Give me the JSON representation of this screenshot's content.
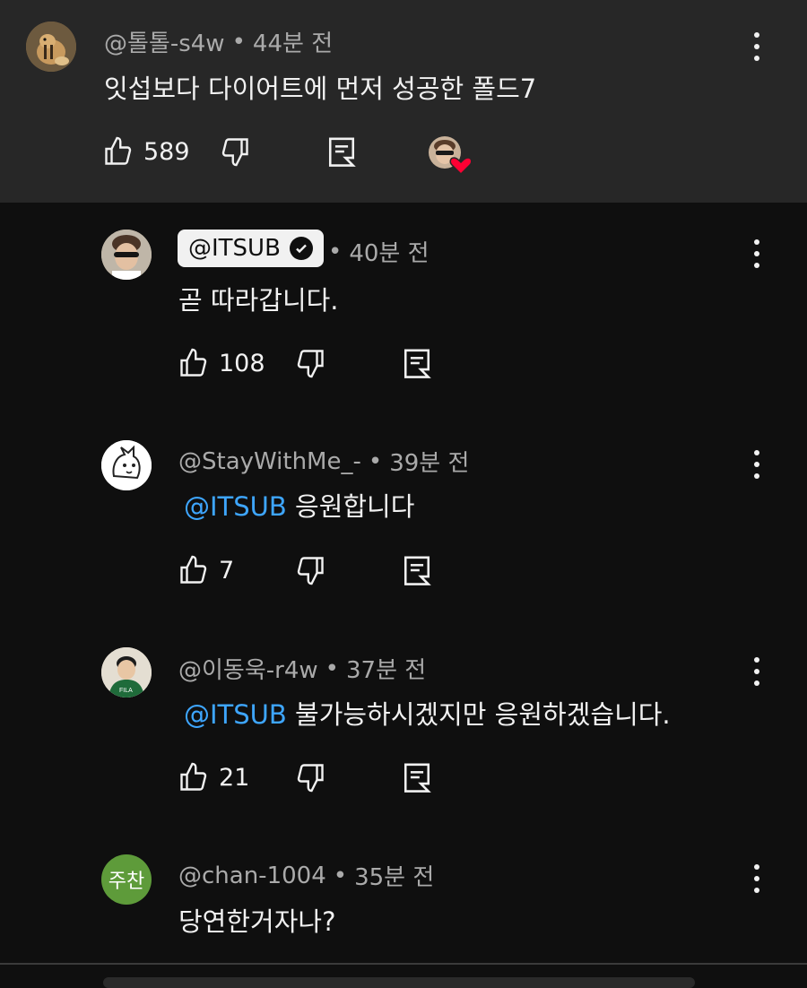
{
  "comments": [
    {
      "handle": "@톨톨-s4w",
      "time": "44분 전",
      "text": "잇섭보다 다이어트에 먼저 성공한 폴드7",
      "likes": "589"
    },
    {
      "handle": "@ITSUB",
      "time": "40분 전",
      "text": "곧 따라갑니다.",
      "likes": "108"
    },
    {
      "handle": "@StayWithMe_-",
      "time": "39분 전",
      "mention": "@ITSUB",
      "text": " 응원합니다",
      "likes": "7"
    },
    {
      "handle": "@이동욱-r4w",
      "time": "37분 전",
      "mention": "@ITSUB",
      "text": " 불가능하시겠지만 응원하겠습니다.",
      "likes": "21"
    },
    {
      "handle": "@chan-1004",
      "time": "35분 전",
      "avatar_initials": "주찬",
      "text": "당연한거자나?"
    }
  ],
  "separator": "•",
  "colors": {
    "mention": "#3ea6ff",
    "heart": "#ff0033",
    "highlight_bg": "#272727"
  }
}
